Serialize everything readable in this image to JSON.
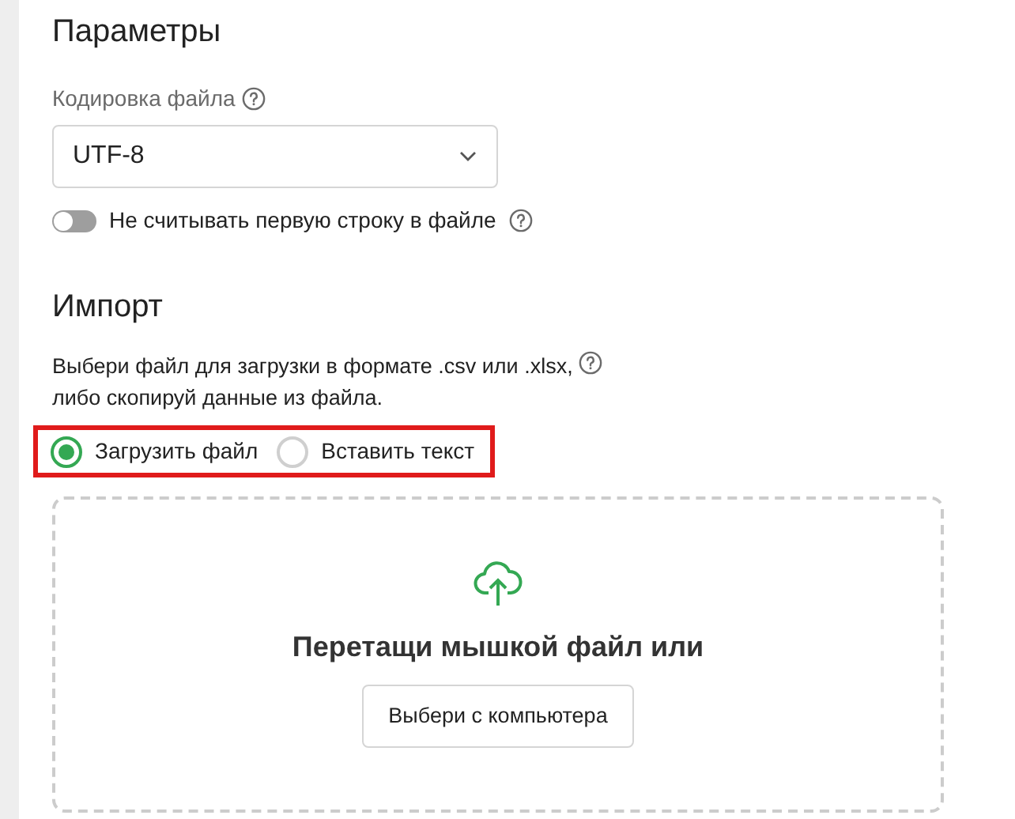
{
  "parameters": {
    "title": "Параметры",
    "encoding": {
      "label": "Кодировка файла",
      "value": "UTF-8"
    },
    "skip_first_row": {
      "label": "Не считывать первую строку в файле",
      "on": false
    }
  },
  "import": {
    "title": "Импорт",
    "description": "Выбери файл для загрузки в формате .csv или .xlsx,\nлибо скопируй данные из файла.",
    "highlighted": true,
    "options": [
      {
        "label": "Загрузить файл",
        "selected": true
      },
      {
        "label": "Вставить текст",
        "selected": false
      }
    ],
    "dropzone": {
      "text": "Перетащи мышкой файл или",
      "button": "Выбери с компьютера"
    }
  }
}
